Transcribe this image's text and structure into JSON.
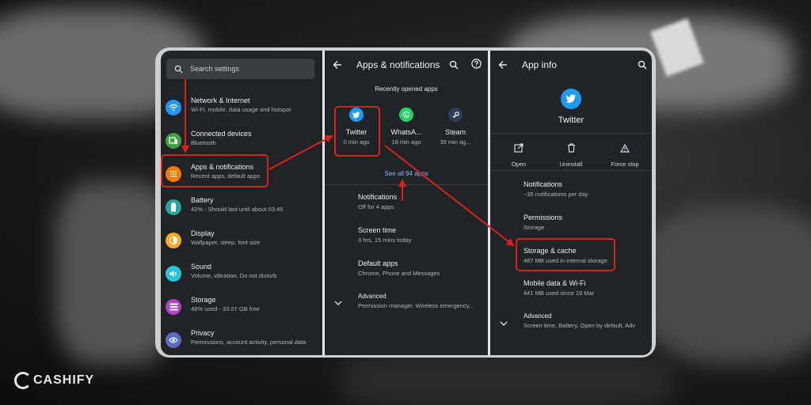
{
  "brand": "CASHIFY",
  "colors": {
    "accent_red": "#d9221c",
    "twitter_blue": "#1d9bf0",
    "link_blue": "#8ab4f8",
    "panel_bg": "#202327"
  },
  "settings": {
    "search_placeholder": "Search settings",
    "items": [
      {
        "label": "Network & Internet",
        "sub": "Wi-Fi, mobile, data usage and hotspot",
        "icon": "wifi-icon",
        "color": "#2196f3"
      },
      {
        "label": "Connected devices",
        "sub": "Bluetooth",
        "icon": "devices-icon",
        "color": "#43a047"
      },
      {
        "label": "Apps & notifications",
        "sub": "Recent apps, default apps",
        "icon": "apps-icon",
        "color": "#f57c00"
      },
      {
        "label": "Battery",
        "sub": "42% - Should last until about 03:45",
        "icon": "battery-icon",
        "color": "#26a69a"
      },
      {
        "label": "Display",
        "sub": "Wallpaper, sleep, font size",
        "icon": "display-icon",
        "color": "#f9a825"
      },
      {
        "label": "Sound",
        "sub": "Volume, vibration, Do not disturb",
        "icon": "sound-icon",
        "color": "#26c6da"
      },
      {
        "label": "Storage",
        "sub": "48% used - 33.07 GB free",
        "icon": "storage-icon",
        "color": "#ab47bc"
      },
      {
        "label": "Privacy",
        "sub": "Permissions, account activity, personal data",
        "icon": "privacy-icon",
        "color": "#5c6bc0"
      }
    ]
  },
  "apps_notifications": {
    "title": "Apps & notifications",
    "recent_label": "Recently opened apps",
    "recent": [
      {
        "name": "Twitter",
        "time": "0 min ago",
        "icon": "twitter-icon",
        "color": "#1d9bf0"
      },
      {
        "name": "WhatsA...",
        "time": "18 min ago",
        "icon": "whatsapp-icon",
        "color": "#25d366"
      },
      {
        "name": "Steam",
        "time": "39 min ag...",
        "icon": "steam-icon",
        "color": "#2a3f5a"
      }
    ],
    "see_all": "See all 94 apps",
    "rows": [
      {
        "label": "Notifications",
        "sub": "Off for 4 apps"
      },
      {
        "label": "Screen time",
        "sub": "3 hrs, 15 mins today"
      },
      {
        "label": "Default apps",
        "sub": "Chrome, Phone and Messages"
      },
      {
        "label": "Advanced",
        "sub": "Permission manager, Wireless emergency..."
      }
    ]
  },
  "app_info": {
    "title": "App info",
    "app_name": "Twitter",
    "actions": [
      {
        "label": "Open",
        "icon": "open-icon"
      },
      {
        "label": "Uninstall",
        "icon": "trash-icon"
      },
      {
        "label": "Force stop",
        "icon": "warning-icon"
      }
    ],
    "rows": [
      {
        "label": "Notifications",
        "sub": "~35 notifications per day"
      },
      {
        "label": "Permissions",
        "sub": "Storage"
      },
      {
        "label": "Storage & cache",
        "sub": "487 MB used in internal storage"
      },
      {
        "label": "Mobile data & Wi-Fi",
        "sub": "441 MB used since 19 Mar"
      },
      {
        "label": "Advanced",
        "sub": "Screen time, Battery, Open by default, Adv"
      }
    ]
  }
}
